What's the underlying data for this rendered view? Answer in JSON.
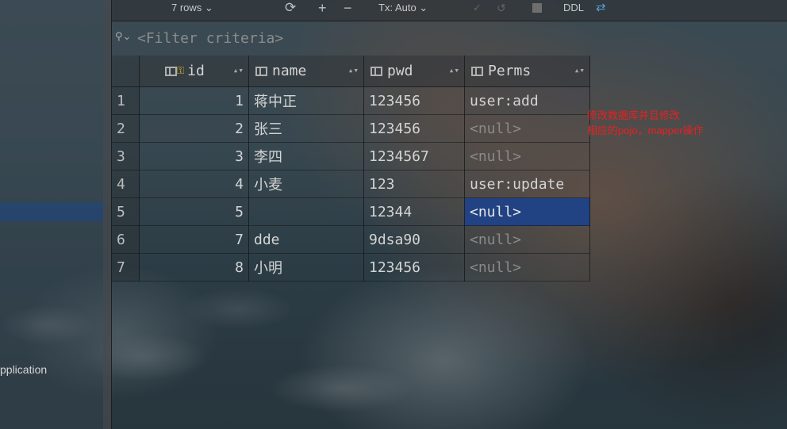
{
  "toolbar": {
    "rows_label": "7 rows ⌄",
    "tx_label": "Tx: Auto ⌄",
    "ddl_label": "DDL"
  },
  "filter": {
    "placeholder": "<Filter criteria>"
  },
  "table": {
    "columns": [
      "id",
      "name",
      "pwd",
      "Perms"
    ],
    "rows": [
      {
        "num": "1",
        "id": "1",
        "name": "蒋中正",
        "pwd": "123456",
        "perms": "user:add"
      },
      {
        "num": "2",
        "id": "2",
        "name": "张三",
        "pwd": "123456",
        "perms": "<null>"
      },
      {
        "num": "3",
        "id": "3",
        "name": "李四",
        "pwd": "1234567",
        "perms": "<null>"
      },
      {
        "num": "4",
        "id": "4",
        "name": "小麦",
        "pwd": "123",
        "perms": "user:update"
      },
      {
        "num": "5",
        "id": "5",
        "name": "",
        "pwd": "12344",
        "perms": "<null>"
      },
      {
        "num": "6",
        "id": "7",
        "name": "dde",
        "pwd": "9dsa90",
        "perms": "<null>"
      },
      {
        "num": "7",
        "id": "8",
        "name": "小明",
        "pwd": "123456",
        "perms": "<null>"
      }
    ]
  },
  "left_panel": {
    "text": "pplication"
  },
  "annotation": {
    "text": "修改数据库并且修改\n相应的pojo，mapper操作"
  },
  "colors": {
    "selection": "#214283",
    "annotation": "#e52222",
    "accent": "#5a9ee0"
  },
  "icons": [
    "refresh-icon",
    "plus-icon",
    "minus-icon",
    "check-icon",
    "revert-icon",
    "stop-icon",
    "compare-icon",
    "filter-icon",
    "key-icon",
    "column-icon"
  ]
}
